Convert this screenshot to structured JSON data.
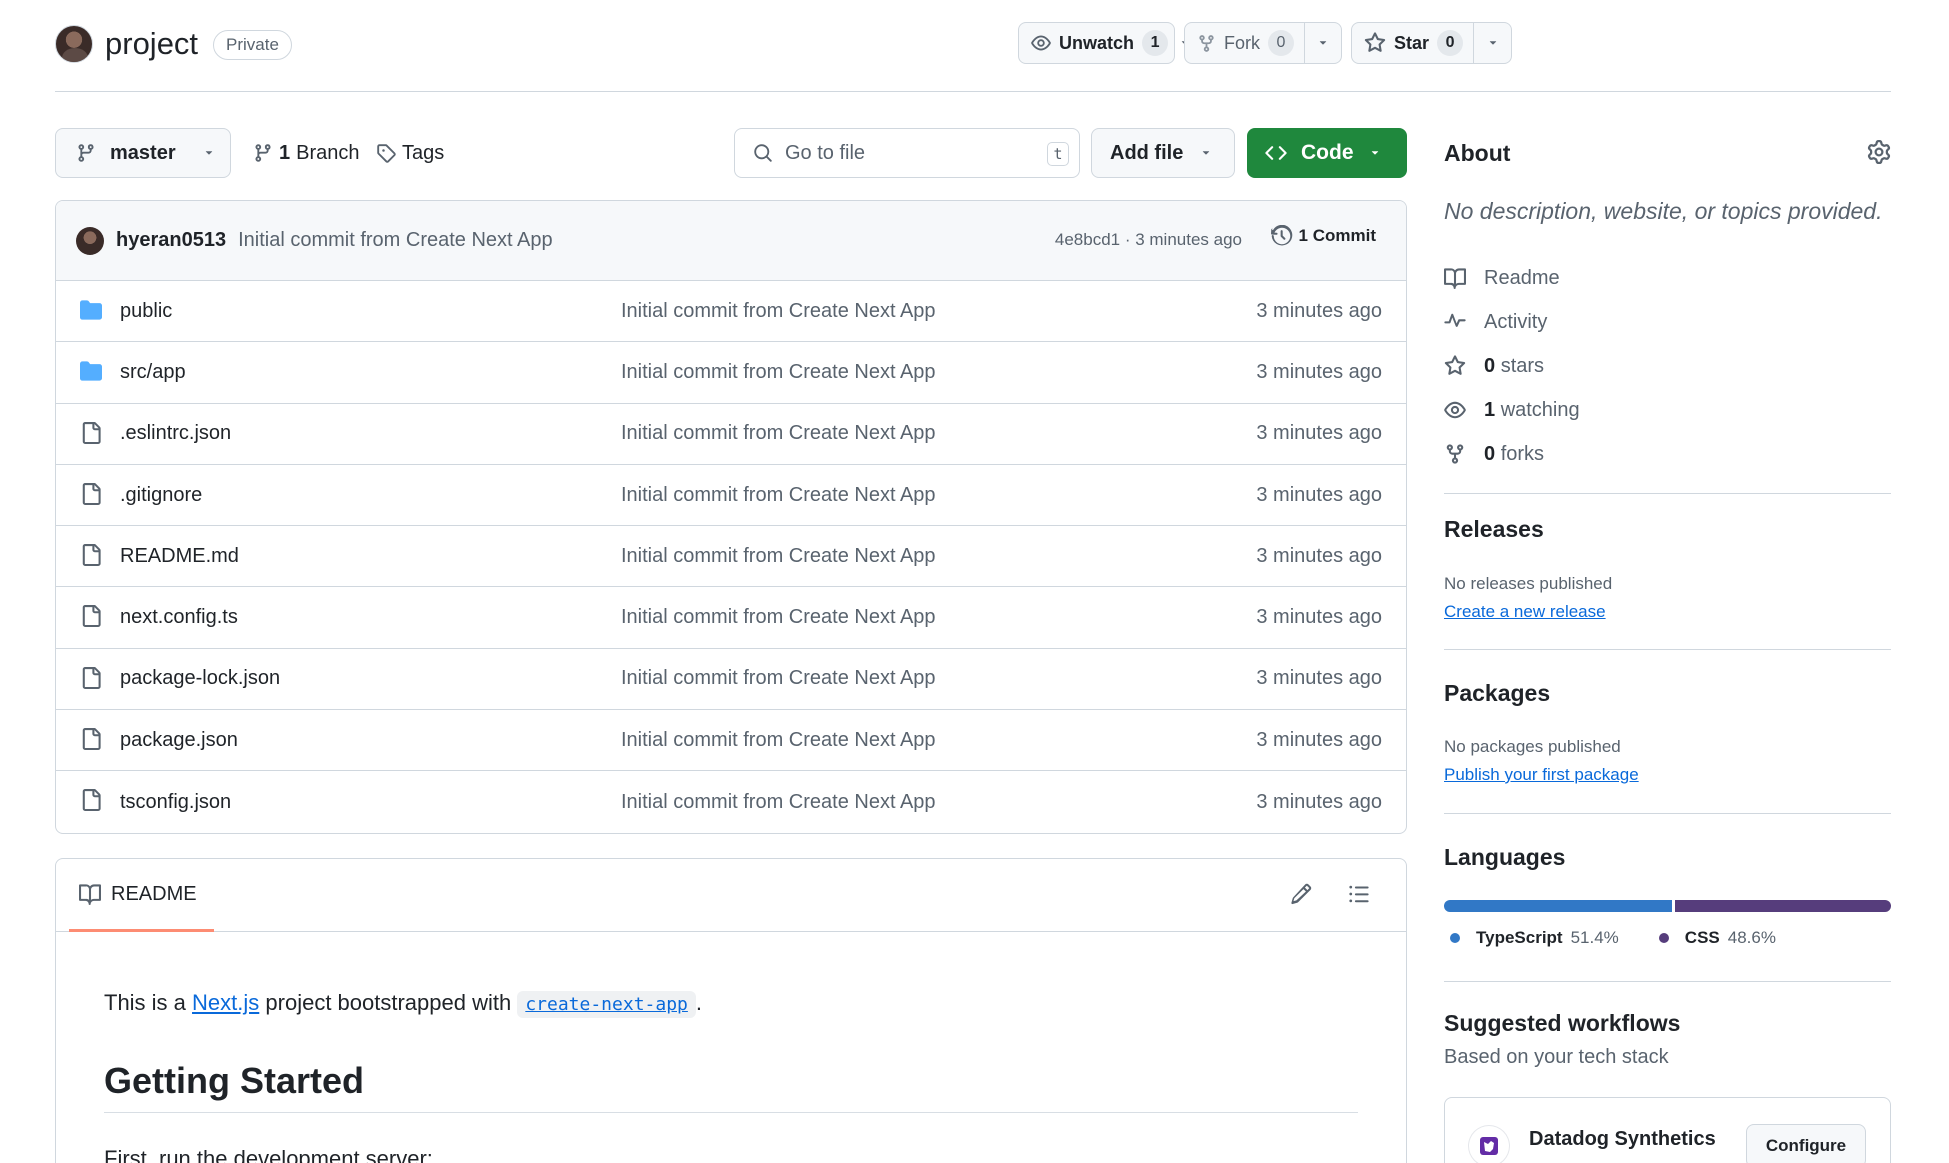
{
  "repo": {
    "name": "project",
    "visibility": "Private"
  },
  "actions": {
    "watch": {
      "label": "Unwatch",
      "count": "1"
    },
    "fork": {
      "label": "Fork",
      "count": "0"
    },
    "star": {
      "label": "Star",
      "count": "0"
    }
  },
  "toolbar": {
    "branch": "master",
    "branches_count": "1",
    "branches_label": "Branch",
    "tags_label": "Tags",
    "search_placeholder": "Go to file",
    "search_shortcut": "t",
    "add_file": "Add file",
    "code": "Code"
  },
  "commit": {
    "author": "hyeran0513",
    "message": "Initial commit from Create Next App",
    "meta": "4e8bcd1 · 3 minutes ago",
    "count_label": "1 Commit"
  },
  "files": [
    {
      "name": "public",
      "type": "folder",
      "message": "Initial commit from Create Next App",
      "time": "3 minutes ago"
    },
    {
      "name": "src/app",
      "type": "folder",
      "message": "Initial commit from Create Next App",
      "time": "3 minutes ago"
    },
    {
      "name": ".eslintrc.json",
      "type": "file",
      "message": "Initial commit from Create Next App",
      "time": "3 minutes ago"
    },
    {
      "name": ".gitignore",
      "type": "file",
      "message": "Initial commit from Create Next App",
      "time": "3 minutes ago"
    },
    {
      "name": "README.md",
      "type": "file",
      "message": "Initial commit from Create Next App",
      "time": "3 minutes ago"
    },
    {
      "name": "next.config.ts",
      "type": "file",
      "message": "Initial commit from Create Next App",
      "time": "3 minutes ago"
    },
    {
      "name": "package-lock.json",
      "type": "file",
      "message": "Initial commit from Create Next App",
      "time": "3 minutes ago"
    },
    {
      "name": "package.json",
      "type": "file",
      "message": "Initial commit from Create Next App",
      "time": "3 minutes ago"
    },
    {
      "name": "tsconfig.json",
      "type": "file",
      "message": "Initial commit from Create Next App",
      "time": "3 minutes ago"
    }
  ],
  "readme": {
    "tab": "README",
    "intro_before": "This is a ",
    "intro_link": "Next.js",
    "intro_middle": " project bootstrapped with ",
    "intro_code": "create-next-app",
    "intro_after": ".",
    "heading": "Getting Started",
    "first_step": "First, run the development server:"
  },
  "about": {
    "title": "About",
    "description": "No description, website, or topics provided.",
    "readme": "Readme",
    "activity": "Activity",
    "stars_count": "0",
    "stars_label": "stars",
    "watching_count": "1",
    "watching_label": "watching",
    "forks_count": "0",
    "forks_label": "forks"
  },
  "releases": {
    "title": "Releases",
    "empty": "No releases published",
    "link": "Create a new release"
  },
  "packages": {
    "title": "Packages",
    "empty": "No packages published",
    "link": "Publish your first package"
  },
  "languages": {
    "title": "Languages",
    "items": [
      {
        "name": "TypeScript",
        "percent": "51.4%",
        "value": 51.4,
        "color": "#3178c6"
      },
      {
        "name": "CSS",
        "percent": "48.6%",
        "value": 48.6,
        "color": "#563d7c"
      }
    ]
  },
  "workflows": {
    "title": "Suggested workflows",
    "subtitle": "Based on your tech stack",
    "item_name": "Datadog Synthetics",
    "item_button": "Configure"
  },
  "colors": {
    "accent": "#0969da",
    "code_button": "#1f883d",
    "folder": "#54aeff",
    "readme_underline": "#fd8c73"
  }
}
